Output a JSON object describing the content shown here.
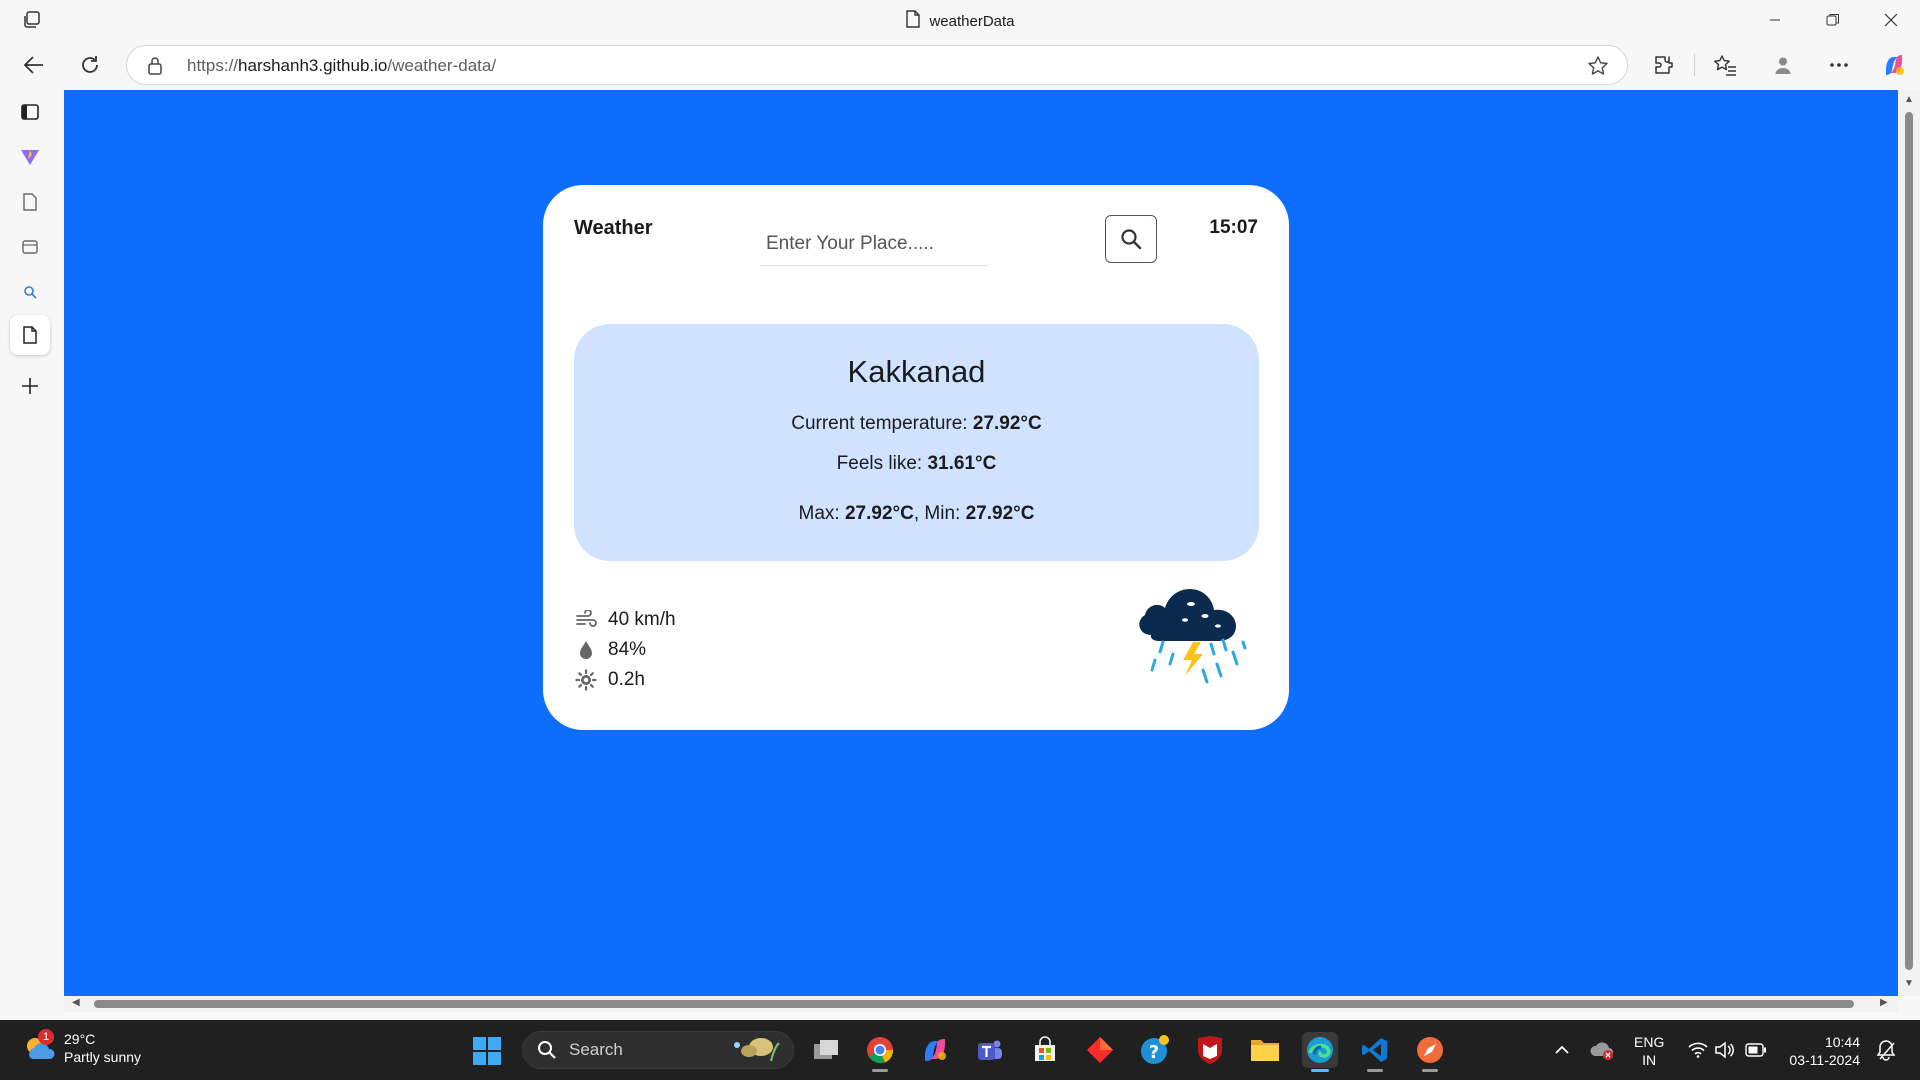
{
  "browser": {
    "tab_title": "weatherData",
    "url_prefix": "https://",
    "url_host": "harshanh3.github.io",
    "url_path": "/weather-data/"
  },
  "app": {
    "title": "Weather",
    "search_placeholder": "Enter Your Place.....",
    "time": "15:07",
    "city": "Kakkanad",
    "current_label": "Current temperature: ",
    "current_value": "27.92°C",
    "feels_label": "Feels like: ",
    "feels_value": "31.61°C",
    "max_label": "Max: ",
    "max_value": "27.92°C",
    "min_label": ", Min: ",
    "min_value": "27.92°C",
    "wind": "40 km/h",
    "humidity": "84%",
    "sunshine": "0.2h",
    "colors": {
      "page_bg": "#0d6efd",
      "card_bg": "#ffffff",
      "panel_bg": "#cfe2ff"
    }
  },
  "taskbar": {
    "weather_temp": "29°C",
    "weather_desc": "Partly sunny",
    "weather_badge": "1",
    "search_label": "Search",
    "lang_line1": "ENG",
    "lang_line2": "IN",
    "time": "10:44",
    "date": "03-11-2024"
  }
}
